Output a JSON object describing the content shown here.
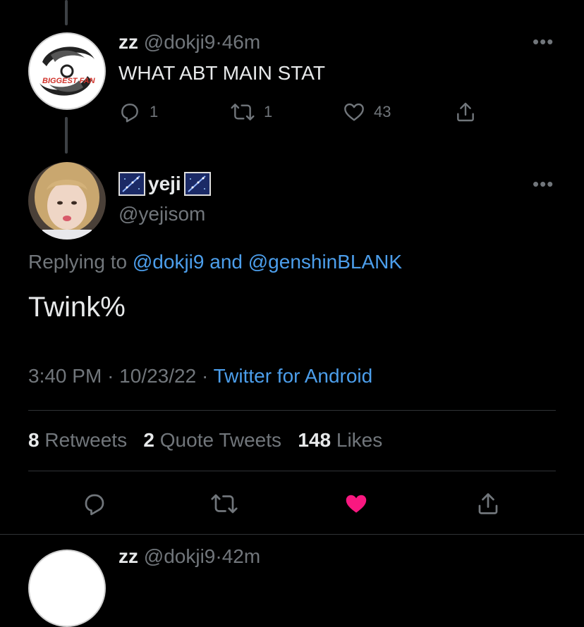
{
  "colors": {
    "background": "#000000",
    "text": "#e7e9ea",
    "muted": "#71767b",
    "link": "#4c9eeb",
    "like_active": "#f91880",
    "divider": "#2f3336"
  },
  "parent_tweet": {
    "display_name": "zz",
    "handle": "@dokji9",
    "separator": "·",
    "time_ago": "46m",
    "text": "WHAT ABT MAIN STAT",
    "avatar_text": "BIGGEST FAN",
    "actions": {
      "reply_count": "1",
      "retweet_count": "1",
      "like_count": "43"
    },
    "icons": [
      "reply-icon",
      "retweet-icon",
      "like-icon",
      "share-icon",
      "more-icon"
    ]
  },
  "main_tweet": {
    "display_name": "yeji",
    "handle": "@yejisom",
    "replying_prefix": "Replying to",
    "replying_user1": "@dokji9",
    "replying_and": "and",
    "replying_user2": "@genshinBLANK",
    "text": "Twink%",
    "time": "3:40 PM",
    "dot": "·",
    "date": "10/23/22",
    "source": "Twitter for Android",
    "stats": {
      "retweets_count": "8",
      "retweets_label": "Retweets",
      "quotes_count": "2",
      "quotes_label": "Quote Tweets",
      "likes_count": "148",
      "likes_label": "Likes"
    },
    "icons": [
      "reply-icon",
      "retweet-icon",
      "like-filled-icon",
      "share-icon",
      "more-icon"
    ]
  },
  "next_tweet": {
    "display_name": "zz",
    "handle": "@dokji9",
    "separator": "·",
    "time_ago": "42m"
  }
}
